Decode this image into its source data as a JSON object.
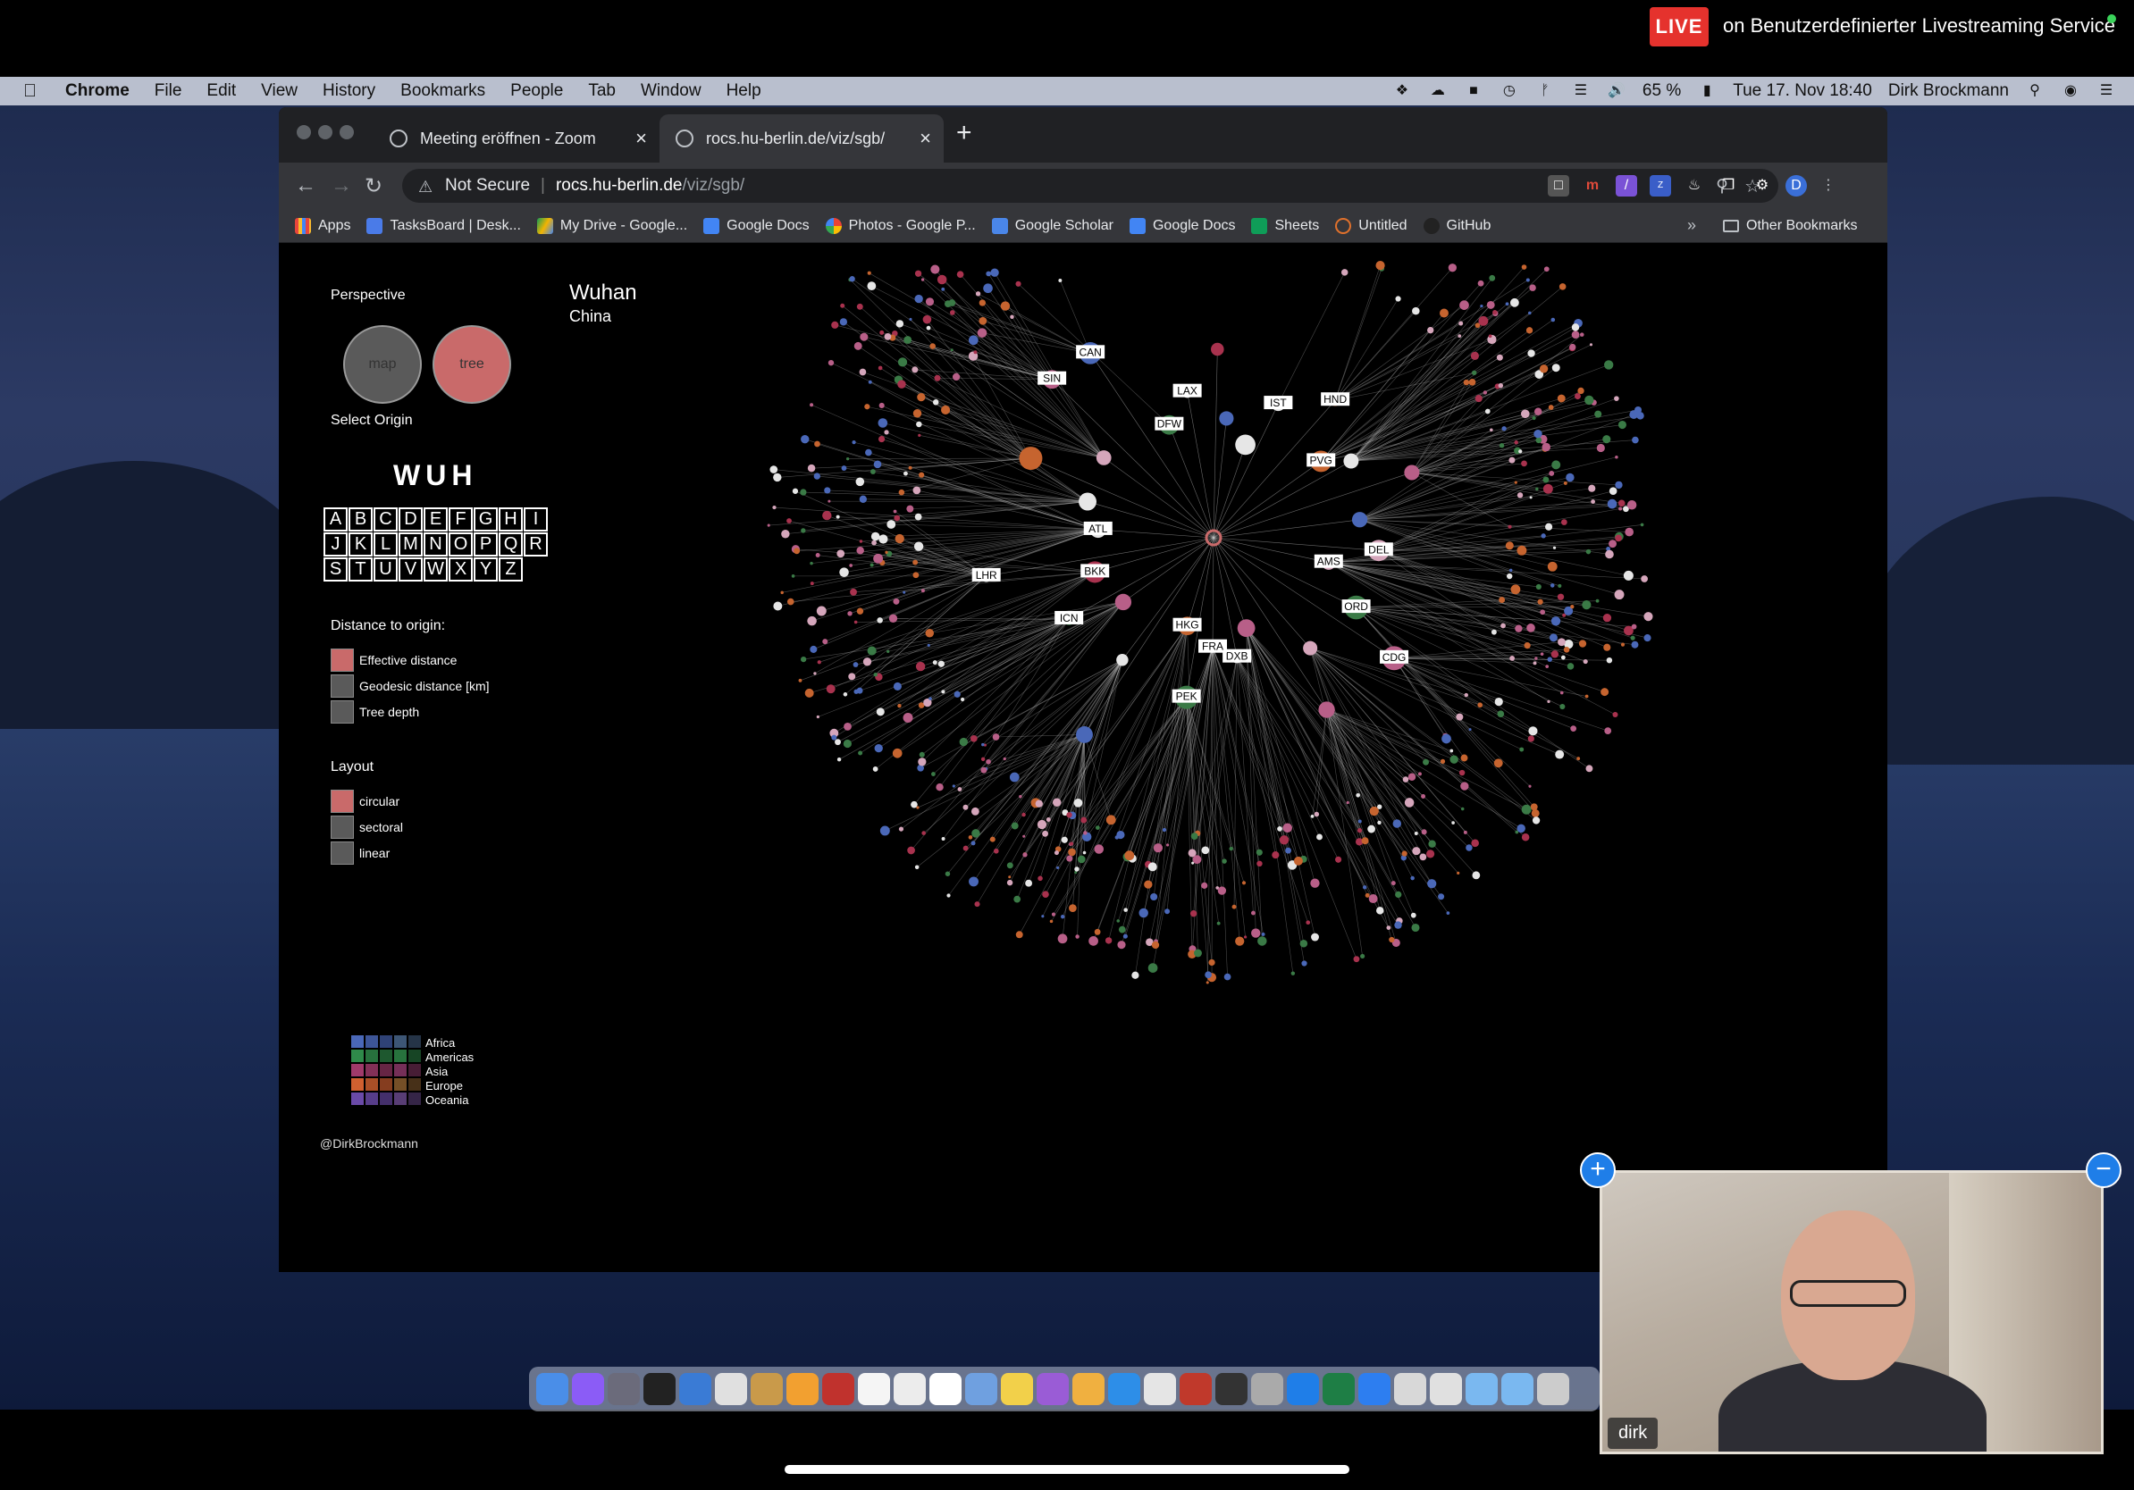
{
  "stream": {
    "live_label": "LIVE",
    "live_text": "on Benutzerdefinierter Livestreaming Service"
  },
  "menubar": {
    "app": "Chrome",
    "items": [
      "File",
      "Edit",
      "View",
      "History",
      "Bookmarks",
      "People",
      "Tab",
      "Window",
      "Help"
    ],
    "battery": "65 %",
    "datetime": "Tue 17. Nov  18:40",
    "user": "Dirk Brockmann"
  },
  "chrome": {
    "tabs": [
      {
        "title": "Meeting eröffnen - Zoom"
      },
      {
        "title": "rocs.hu-berlin.de/viz/sgb/"
      }
    ],
    "omnibox": {
      "security": "Not Secure",
      "host": "rocs.hu-berlin.de",
      "path": "/viz/sgb/"
    },
    "profile_initial": "D",
    "bookmarks": [
      "Apps",
      "TasksBoard | Desk...",
      "My Drive - Google...",
      "Google Docs",
      "Photos - Google P...",
      "Google Scholar",
      "Google Docs",
      "Sheets",
      "Untitled",
      "GitHub"
    ],
    "bookmarks_more": "»",
    "other_bookmarks": "Other Bookmarks"
  },
  "viz": {
    "city": "Wuhan",
    "country": "China",
    "perspective_label": "Perspective",
    "perspective_map": "map",
    "perspective_tree": "tree",
    "select_origin_label": "Select Origin",
    "origin_code": "WUH",
    "letters": [
      "A",
      "B",
      "C",
      "D",
      "E",
      "F",
      "G",
      "H",
      "I",
      "J",
      "K",
      "L",
      "M",
      "N",
      "O",
      "P",
      "Q",
      "R",
      "S",
      "T",
      "U",
      "V",
      "W",
      "X",
      "Y",
      "Z"
    ],
    "distance_label": "Distance to origin:",
    "distance_options": [
      "Effective distance",
      "Geodesic distance [km]",
      "Tree depth"
    ],
    "layout_label": "Layout",
    "layout_options": [
      "circular",
      "sectoral",
      "linear"
    ],
    "regions": [
      "Africa",
      "Americas",
      "Asia",
      "Europe",
      "Oceania"
    ],
    "region_colors": [
      "#4a68b8",
      "#2f8a4a",
      "#a03a6a",
      "#d06030",
      "#6a4aa8"
    ],
    "credit": "@DirkBrockmann",
    "airport_labels": [
      "DEL",
      "DXB",
      "ICN",
      "SIN",
      "IST",
      "AMS",
      "FRA",
      "BKK",
      "CAN",
      "HND",
      "ORD",
      "PEK",
      "LHR",
      "DFW",
      "PVG",
      "CDG",
      "HKG",
      "ATL",
      "LAX"
    ],
    "active_color": "#c96a6a"
  },
  "video": {
    "participant": "dirk"
  },
  "dock": {
    "icons": [
      "finder-icon",
      "tasks-icon",
      "system-prefs-icon",
      "terminal-icon",
      "preview-icon",
      "chrome-icon",
      "notes-icon",
      "numbers-icon",
      "acrobat-icon",
      "pages-icon",
      "scripting-icon",
      "calendar-icon",
      "keynote-icon",
      "stickies-icon",
      "flower-icon",
      "weather-icon",
      "appstore-icon",
      "slack-icon",
      "pdf-icon",
      "matlab-icon",
      "automator-icon",
      "skype-icon",
      "excel-icon",
      "zoom-icon",
      "doc-icon",
      "doc2-icon",
      "folder-icon",
      "folder2-icon",
      "trash-icon"
    ]
  }
}
